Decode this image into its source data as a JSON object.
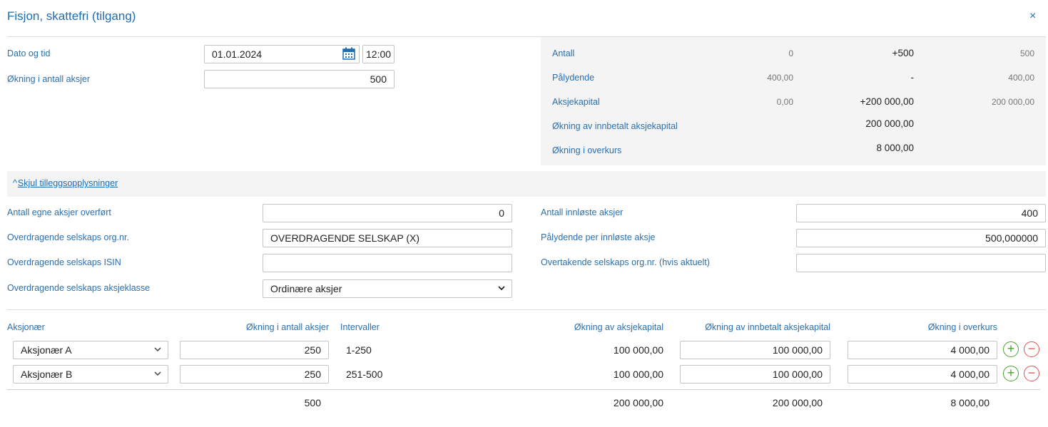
{
  "dialog": {
    "title": "Fisjon, skattefri (tilgang)",
    "close_glyph": "×",
    "colors": {
      "accent": "#1f6db1",
      "plus": "#4aa02c",
      "minus": "#d9534f",
      "panel_bg": "#f4f4f4"
    }
  },
  "form": {
    "date_label": "Dato og tid",
    "date_value": "01.01.2024",
    "time_value": "12:00",
    "increase_label": "Økning i antall aksjer",
    "increase_value": "500"
  },
  "summary": {
    "rows": [
      {
        "label": "Antall",
        "before": "0",
        "change": "+500",
        "after": "500"
      },
      {
        "label": "Pålydende",
        "before": "400,00",
        "change": "-",
        "after": "400,00"
      },
      {
        "label": "Aksjekapital",
        "before": "0,00",
        "change": "+200 000,00",
        "after": "200 000,00"
      },
      {
        "label": "Økning av innbetalt aksjekapital",
        "change": "200 000,00"
      },
      {
        "label": "Økning i overkurs",
        "change": "8 000,00"
      }
    ]
  },
  "toggle": {
    "icon": "chevron-up-icon",
    "caret": "^",
    "label": "Skjul tilleggsopplysninger"
  },
  "extra": {
    "own_shares_label": "Antall egne aksjer overført",
    "own_shares_value": "0",
    "transferor_org_label": "Overdragende selskaps org.nr.",
    "transferor_org_value": "OVERDRAGENDE SELSKAP (X)",
    "transferor_isin_label": "Overdragende selskaps ISIN",
    "transferor_isin_value": "",
    "transferor_class_label": "Overdragende selskaps aksjeklasse",
    "transferor_class_value": "Ordinære aksjer",
    "redeemed_label": "Antall innløste aksjer",
    "redeemed_value": "400",
    "par_per_redeemed_label": "Pålydende per innløste aksje",
    "par_per_redeemed_value": "500,000000",
    "acquirer_org_label": "Overtakende selskaps org.nr. (hvis aktuelt)",
    "acquirer_org_value": ""
  },
  "table": {
    "headers": {
      "shareholder": "Aksjonær",
      "increase": "Økning i antall aksjer",
      "intervals": "Intervaller",
      "capital": "Økning av aksjekapital",
      "paid_capital": "Økning av innbetalt aksjekapital",
      "premium": "Økning i overkurs"
    },
    "rows": [
      {
        "shareholder": "Aksjonær A",
        "increase": "250",
        "interval": "1-250",
        "capital": "100 000,00",
        "paid_capital": "100 000,00",
        "premium": "4 000,00"
      },
      {
        "shareholder": "Aksjonær B",
        "increase": "250",
        "interval": "251-500",
        "capital": "100 000,00",
        "paid_capital": "100 000,00",
        "premium": "4 000,00"
      }
    ],
    "totals": {
      "increase": "500",
      "capital": "200 000,00",
      "paid_capital": "200 000,00",
      "premium": "8 000,00"
    },
    "add_glyph": "+",
    "remove_glyph": "−"
  }
}
